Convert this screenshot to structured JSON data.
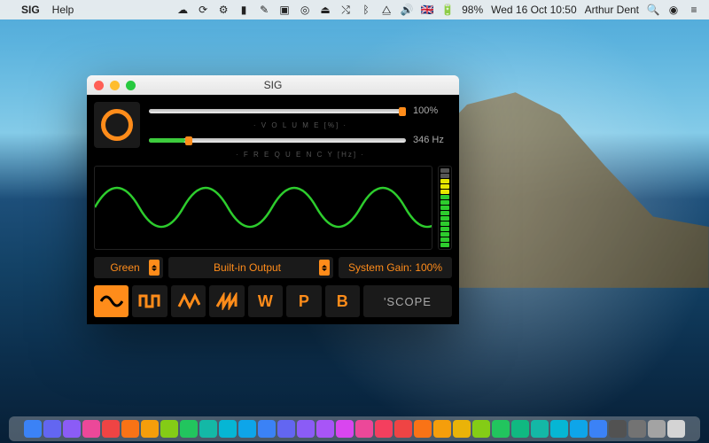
{
  "menubar": {
    "app_name": "SIG",
    "help": "Help",
    "battery": "98%",
    "datetime": "Wed 16 Oct  10:50",
    "user": "Arthur Dent"
  },
  "window": {
    "title": "SIG",
    "volume": {
      "label": "· V O L U M E  [%] ·",
      "value_text": "100%",
      "value": 100,
      "max": 100
    },
    "frequency": {
      "label": "· F R E Q U E N C Y  [Hz] ·",
      "value_text": "346 Hz",
      "value": 346
    },
    "color_select": {
      "value": "Green"
    },
    "output_select": {
      "value": "Built-in Output"
    },
    "gain": {
      "text": "System Gain: 100%"
    },
    "wave_buttons": {
      "sine": "sine",
      "square": "square",
      "triangle": "triangle",
      "saw": "saw",
      "w": "W",
      "p": "P",
      "b": "B"
    },
    "scope": "'SCOPE"
  },
  "colors": {
    "accent": "#ff8c1a",
    "wave": "#2dcc2d"
  },
  "chart_data": {
    "type": "line",
    "title": "Oscilloscope",
    "waveform": "sine",
    "cycles_shown": 3.75,
    "amplitude_pct": 90,
    "frequency_hz": 346,
    "xlabel": "",
    "ylabel": ""
  }
}
